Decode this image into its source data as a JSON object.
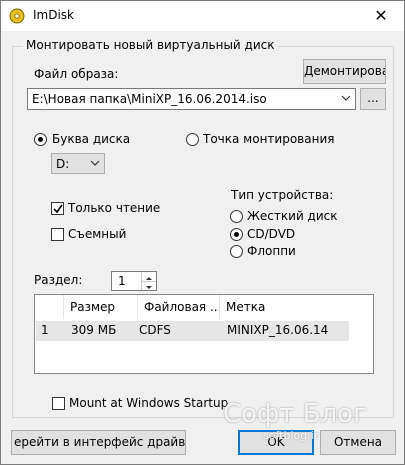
{
  "window": {
    "title": "ImDisk",
    "close": "✕"
  },
  "group": {
    "title": "Монтировать новый виртуальный диск"
  },
  "image": {
    "label": "Файл образа:",
    "unmount_label": "Демонтироват",
    "path": "E:\\Новая папка\\MiniXP_16.06.2014.iso",
    "browse": "..."
  },
  "mount": {
    "drive_letter_label": "Буква диска",
    "mount_point_label": "Точка монтирования",
    "drive_letter_value": "D:",
    "selected": "drive_letter"
  },
  "options": {
    "readonly_label": "Только чтение",
    "readonly_checked": true,
    "removable_label": "Съемный",
    "removable_checked": false
  },
  "device": {
    "title": "Тип устройства:",
    "hdd": "Жесткий диск",
    "cd": "CD/DVD",
    "floppy": "Флоппи",
    "selected": "cd"
  },
  "partition": {
    "label": "Раздел:",
    "value": "1"
  },
  "table": {
    "headers": [
      "",
      "Размер",
      "Файловая ...",
      "Метка"
    ],
    "rows": [
      {
        "num": "1",
        "size": "309 МБ",
        "fs": "CDFS",
        "label": "MINIXP_16.06.14"
      }
    ]
  },
  "startup": {
    "label": "Mount at Windows Startup",
    "checked": false
  },
  "footer": {
    "driver_button": "ерейти в интерфейс драйвер",
    "ok": "OK",
    "cancel": "Отмена"
  },
  "watermark": {
    "main": "Софт Блог",
    "sub": "softblog.in"
  }
}
